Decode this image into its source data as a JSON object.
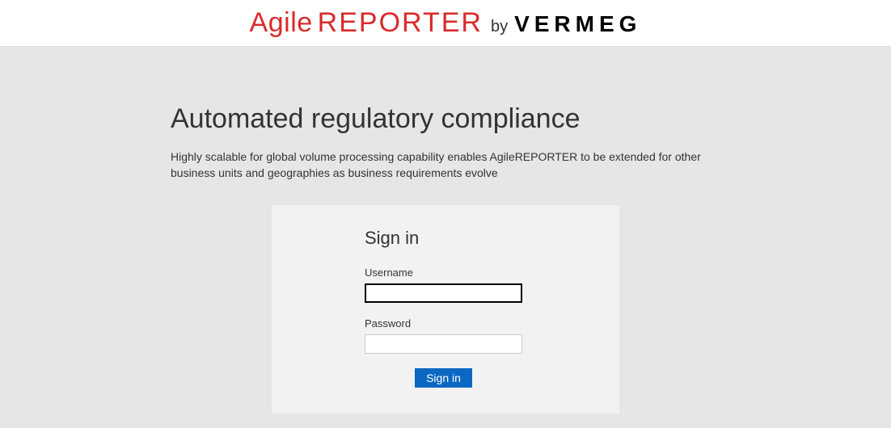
{
  "header": {
    "logo_agile": "Agile",
    "logo_reporter": "REPORTER",
    "logo_by": "by",
    "logo_vermeg": "VERMEG"
  },
  "main": {
    "heading": "Automated regulatory compliance",
    "description": "Highly scalable for global volume processing capability enables AgileREPORTER to be extended for other business units and geographies as business requirements evolve"
  },
  "signin": {
    "title": "Sign in",
    "username_label": "Username",
    "username_value": "",
    "password_label": "Password",
    "password_value": "",
    "button_label": "Sign in"
  }
}
